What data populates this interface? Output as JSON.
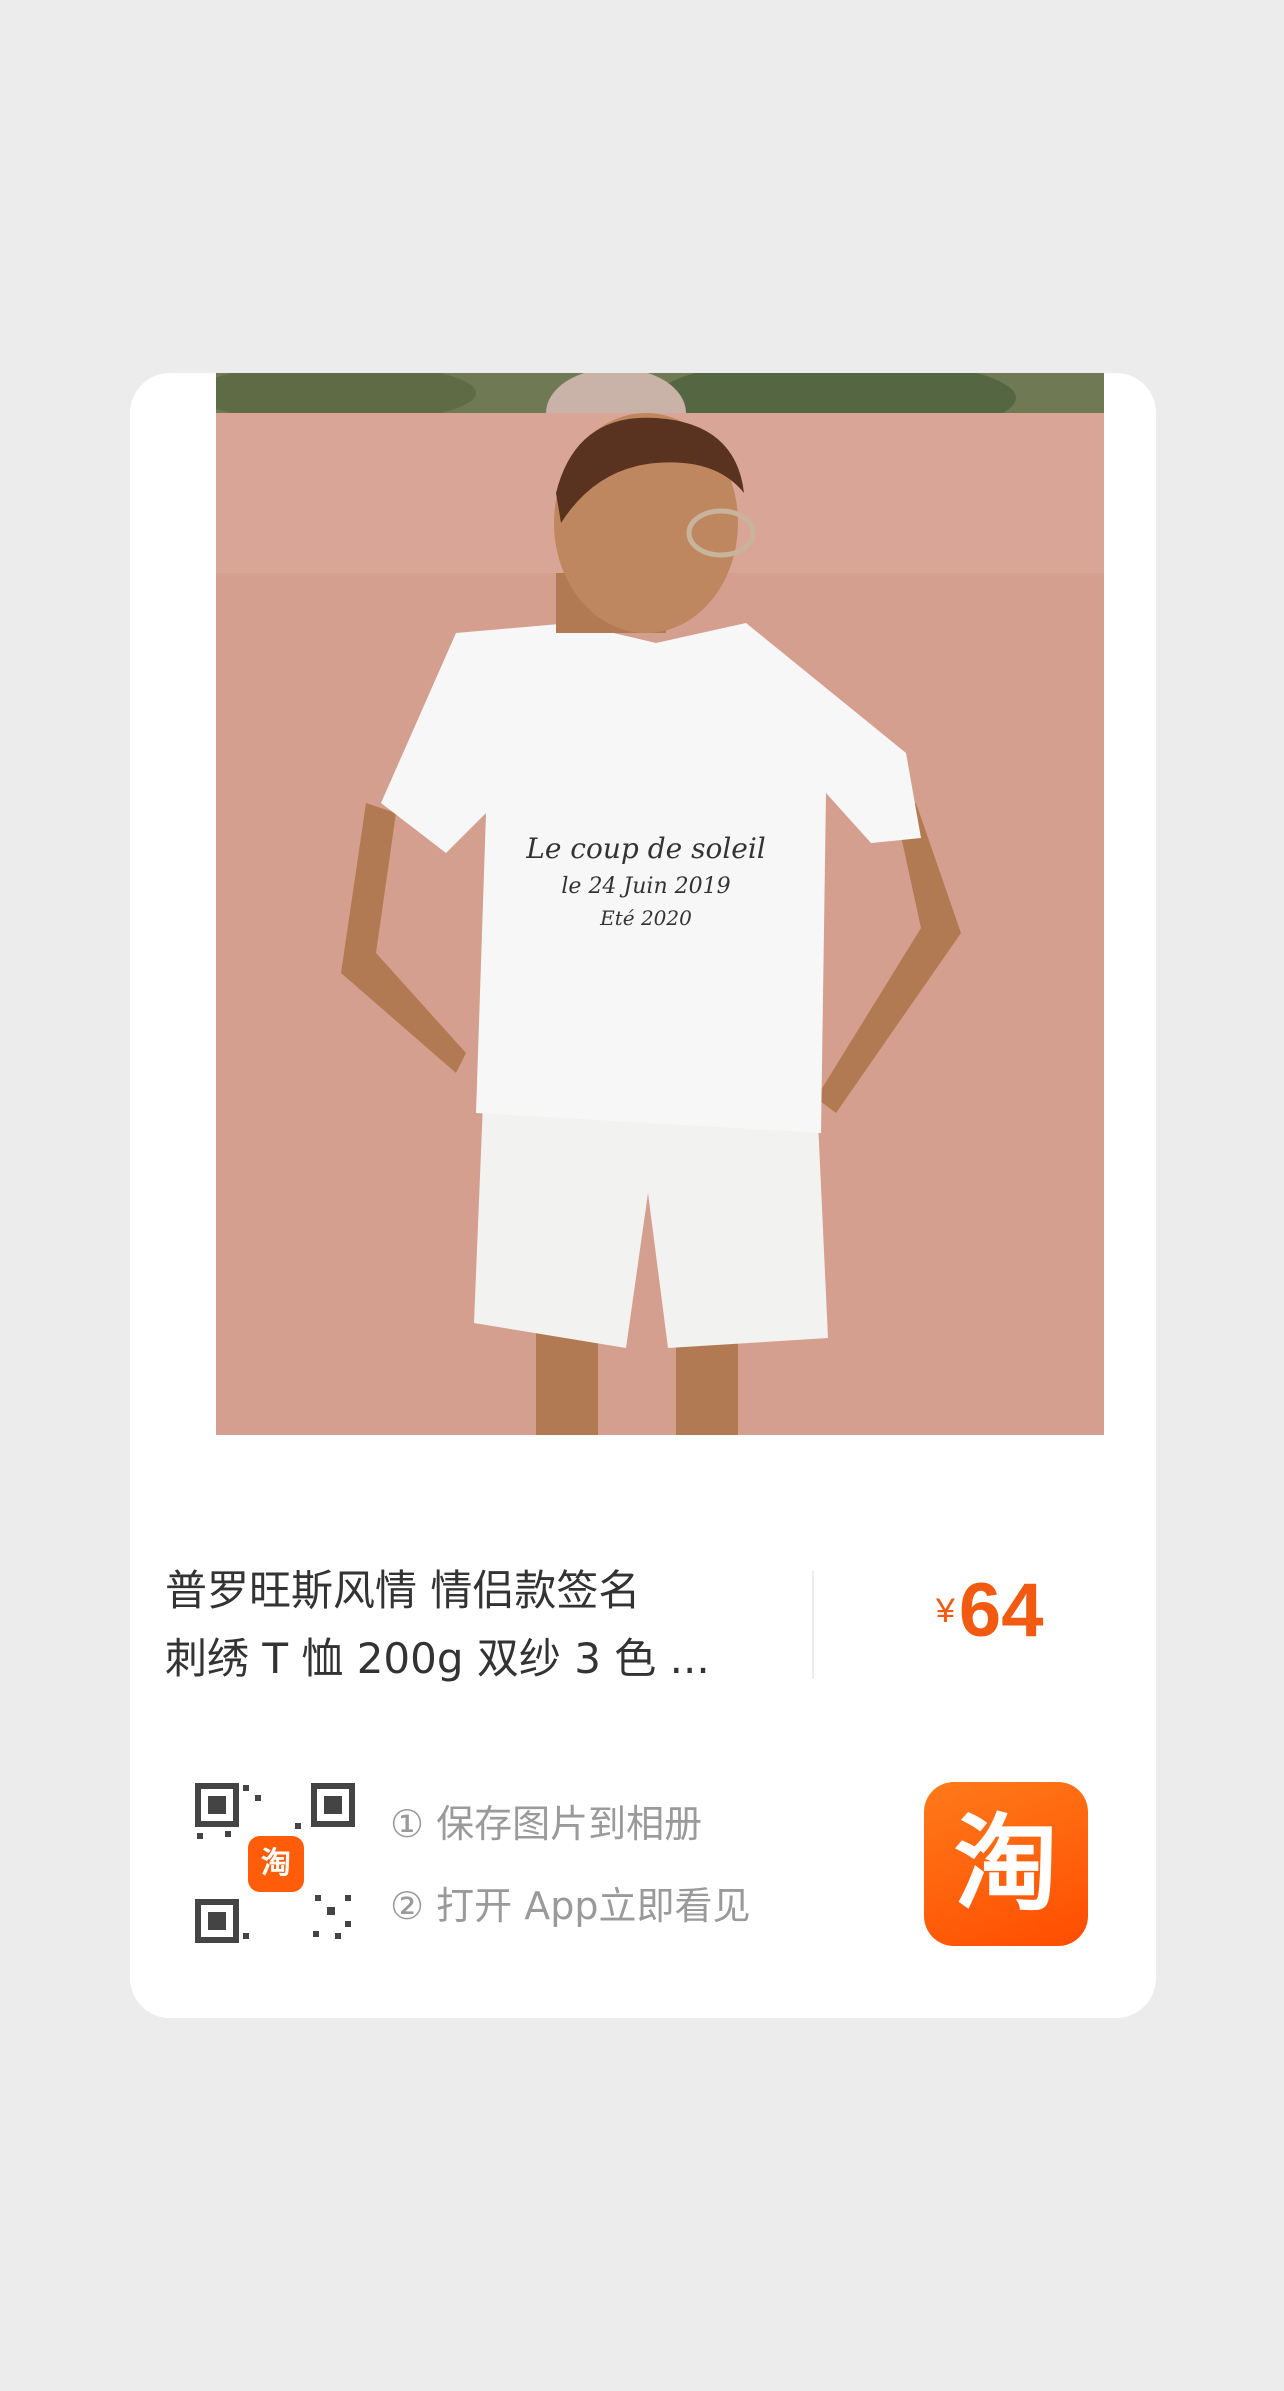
{
  "product": {
    "title_line1": "普罗旺斯风情 情侣款签名",
    "title_line2": "刺绣 T 恤 200g 双纱 3 色 ...",
    "currency": "¥",
    "price": "64",
    "image_caption": [
      "Le coup de soleil",
      "le 24 Juin 2019",
      "Eté 2020"
    ]
  },
  "share": {
    "qr_logo_glyph": "淘",
    "step1": "① 保存图片到相册",
    "step2": "② 打开 App立即看见"
  },
  "app_icon": {
    "glyph": "淘",
    "name": "taobao-app-icon"
  },
  "colors": {
    "accent": "#f25a12",
    "background": "#ececec",
    "card": "#ffffff"
  }
}
